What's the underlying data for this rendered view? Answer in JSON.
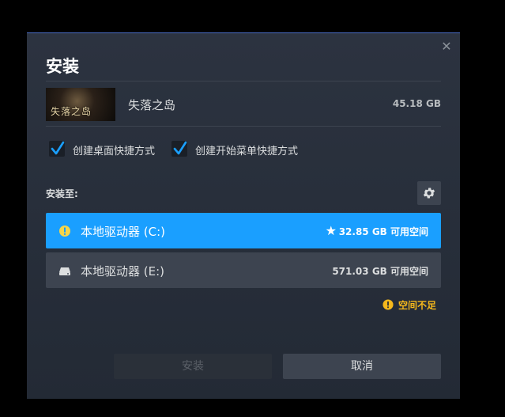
{
  "dialog": {
    "title": "安装",
    "close_icon": "close-icon"
  },
  "game": {
    "name": "失落之岛",
    "thumbnail_text": "失落之岛",
    "size": "45.18 GB"
  },
  "options": {
    "desktop_shortcut": {
      "label": "创建桌面快捷方式",
      "checked": true
    },
    "startmenu_shortcut": {
      "label": "创建开始菜单快捷方式",
      "checked": true
    }
  },
  "install_location": {
    "label": "安装至:",
    "settings_icon": "gear-icon",
    "drives": [
      {
        "name": "本地驱动器 (C:)",
        "free": "32.85 GB 可用空间",
        "selected": true,
        "default": true,
        "icon": "warning-icon"
      },
      {
        "name": "本地驱动器 (E:)",
        "free": "571.03 GB 可用空间",
        "selected": false,
        "default": false,
        "icon": "drive-icon"
      }
    ],
    "warning": "空间不足"
  },
  "buttons": {
    "install": "安装",
    "cancel": "取消"
  },
  "colors": {
    "accent": "#1a9fff",
    "warning": "#f5b81c",
    "dialog_bg": "#2c3340",
    "button_bg": "#3d4450"
  }
}
